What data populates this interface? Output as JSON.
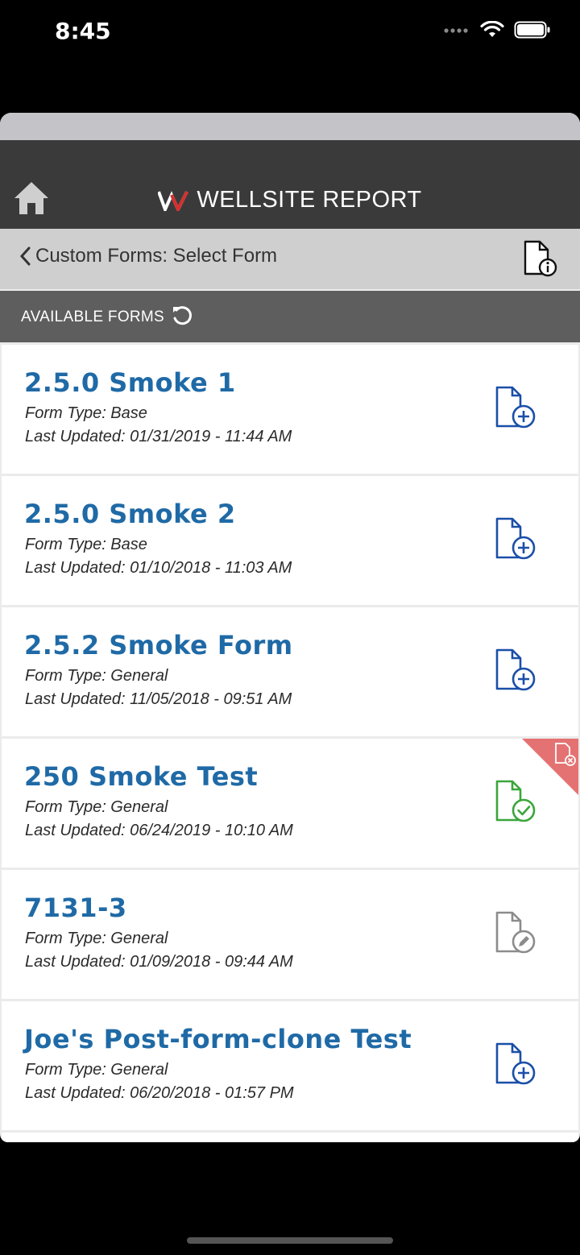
{
  "status_bar": {
    "time": "8:45"
  },
  "app": {
    "brand": "WELLSITE REPORT"
  },
  "nav": {
    "title": "Custom Forms: Select Form"
  },
  "section": {
    "label": "AVAILABLE FORMS"
  },
  "colors": {
    "title_blue": "#1f6aa6",
    "icon_blue": "#1a4fa8",
    "icon_green": "#3aa63a",
    "icon_gray": "#8c8c8c",
    "corner_red": "#e57272"
  },
  "forms": [
    {
      "title": "2.5.0 Smoke 1",
      "type": "Form Type: Base",
      "updated": "Last Updated: 01/31/2019 - 11:44 AM",
      "icon": "file-add-icon"
    },
    {
      "title": "2.5.0 Smoke 2",
      "type": "Form Type: Base",
      "updated": "Last Updated: 01/10/2018 - 11:03 AM",
      "icon": "file-add-icon"
    },
    {
      "title": "2.5.2 Smoke Form",
      "type": "Form Type: General",
      "updated": "Last Updated: 11/05/2018 - 09:51 AM",
      "icon": "file-add-icon"
    },
    {
      "title": "250 Smoke Test",
      "type": "Form Type: General",
      "updated": "Last Updated: 06/24/2019 - 10:10 AM",
      "icon": "file-check-icon"
    },
    {
      "title": "7131-3",
      "type": "Form Type: General",
      "updated": "Last Updated: 01/09/2018 - 09:44 AM",
      "icon": "file-edit-icon"
    },
    {
      "title": "Joe's Post-form-clone Test",
      "type": "Form Type: General",
      "updated": "Last Updated: 06/20/2018 - 01:57 PM",
      "icon": "file-add-icon"
    }
  ]
}
